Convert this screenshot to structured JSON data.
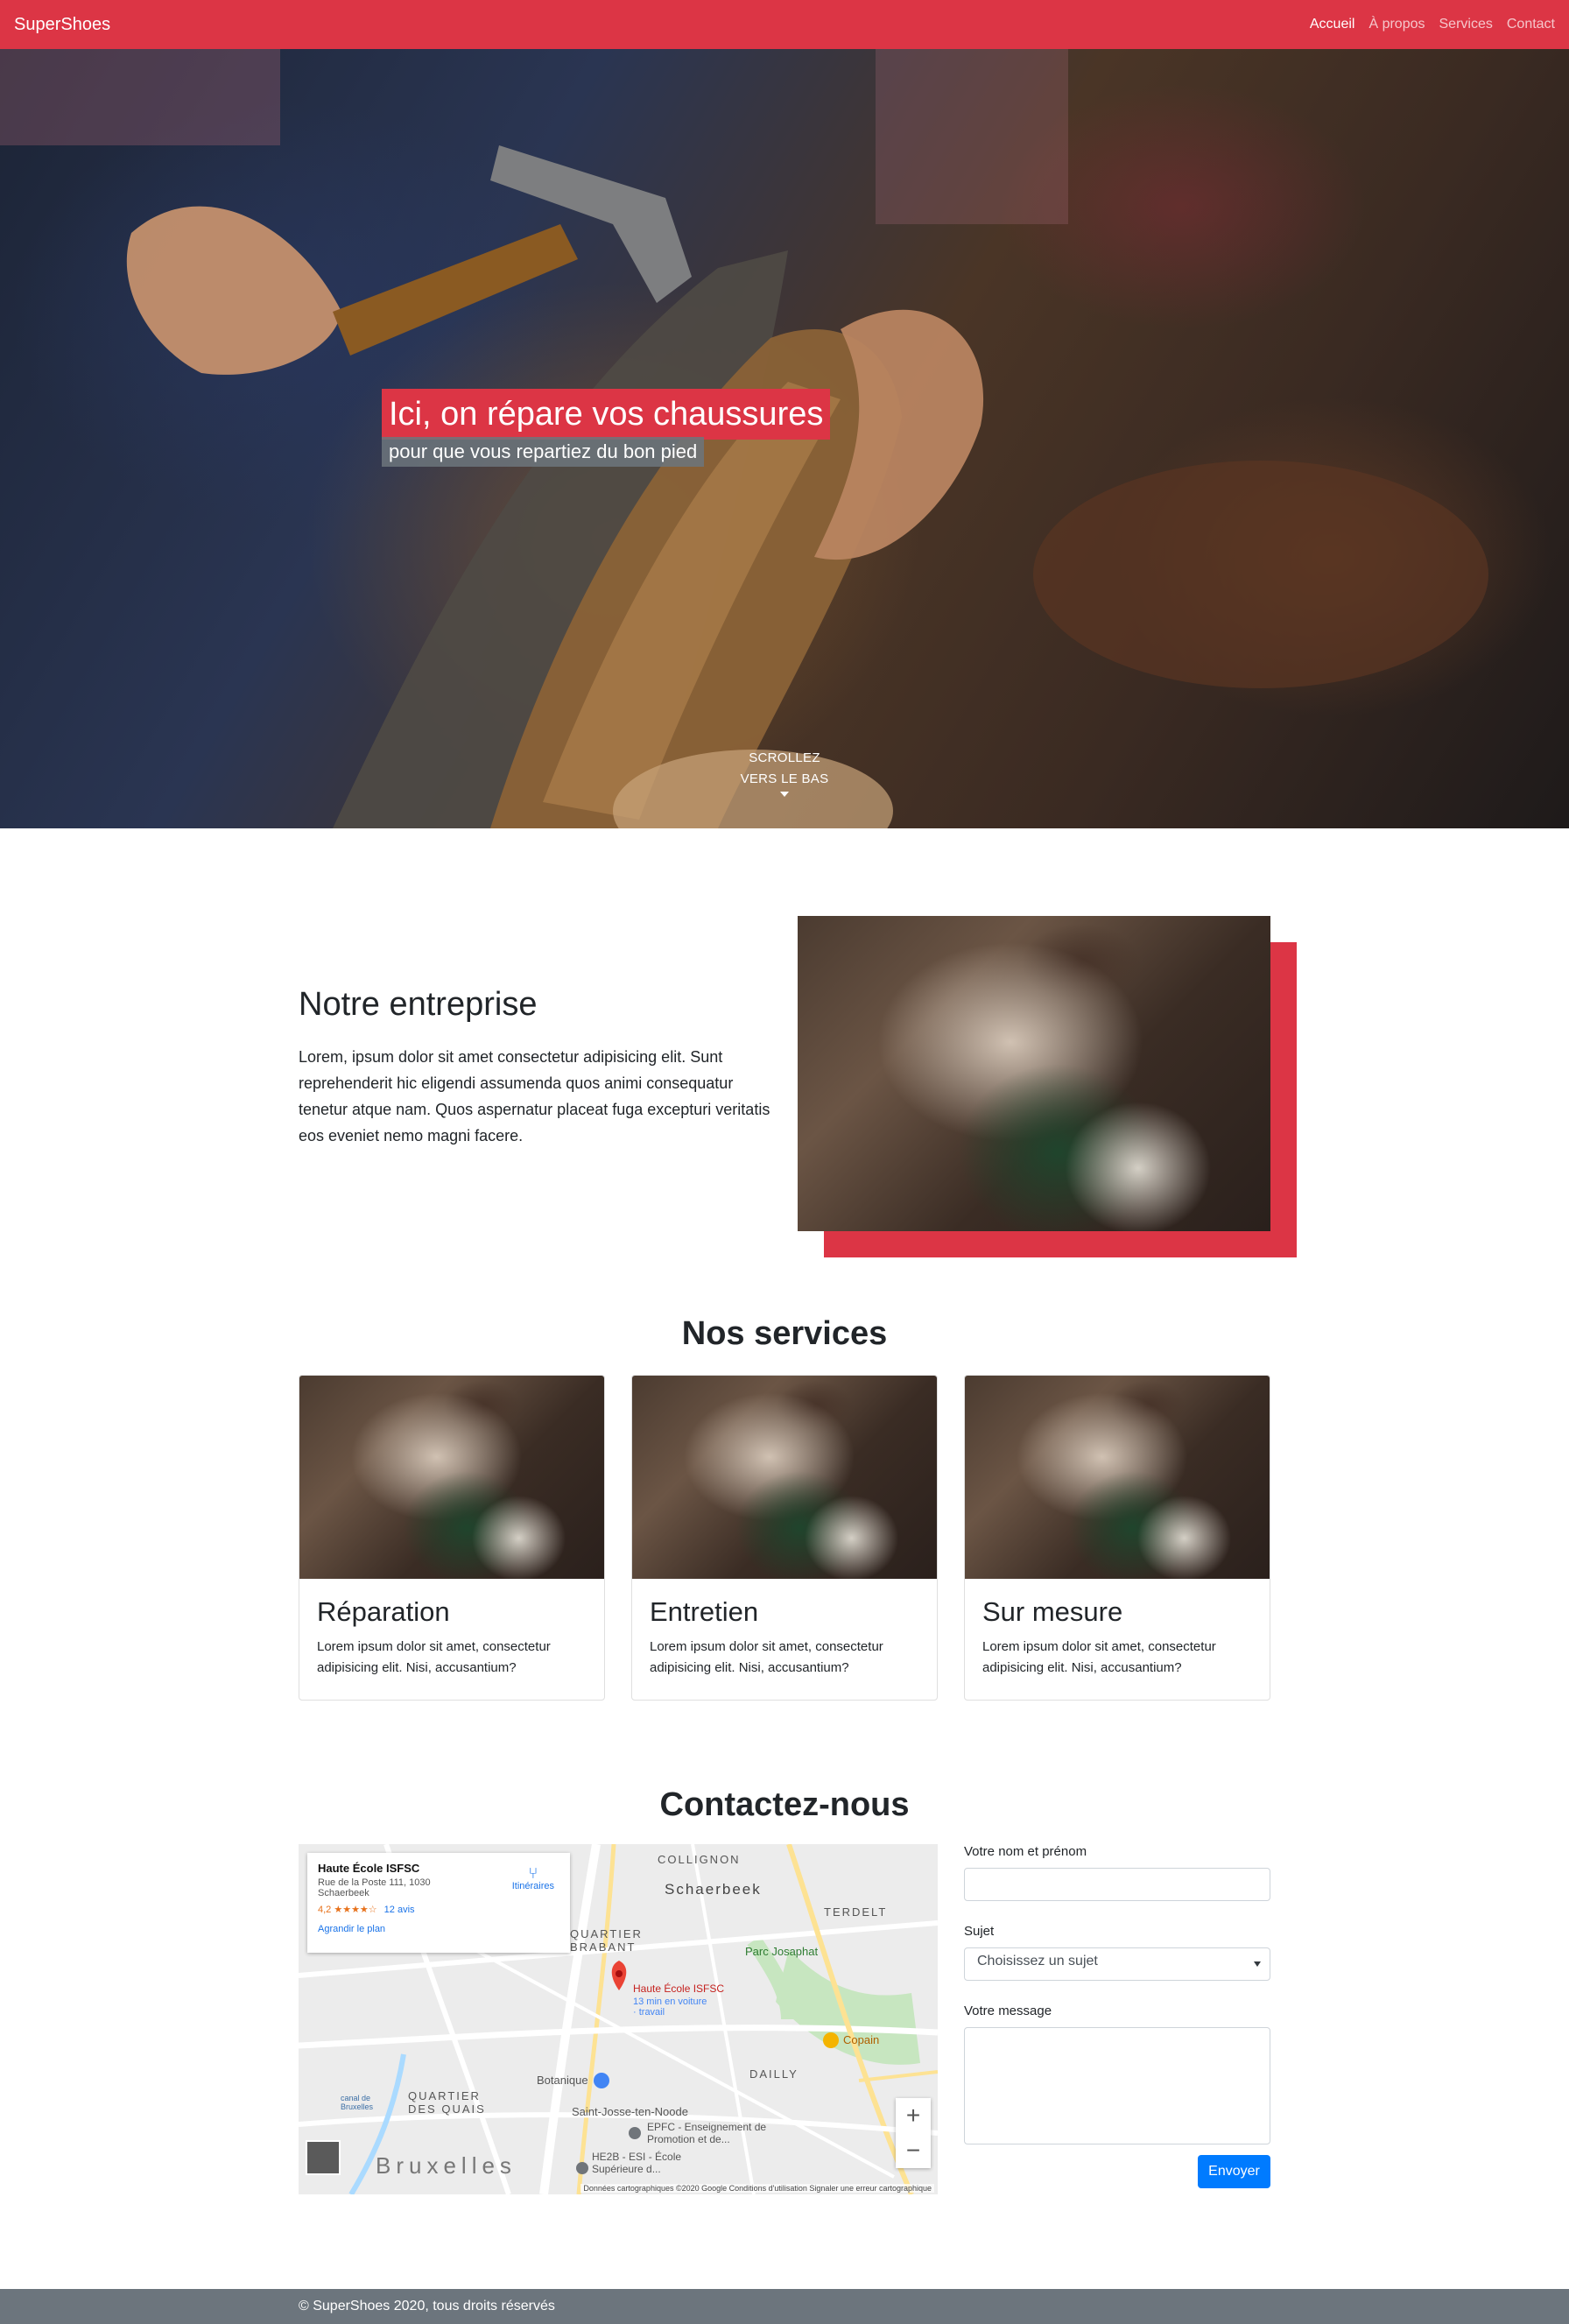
{
  "navbar": {
    "brand": "SuperShoes",
    "links": [
      "Accueil",
      "À propos",
      "Services",
      "Contact"
    ],
    "active_index": 0
  },
  "hero": {
    "title": "Ici, on répare vos chaussures",
    "subtitle": "pour que vous repartiez du bon pied",
    "scroll_line1": "SCROLLEZ",
    "scroll_line2": "VERS LE BAS"
  },
  "about": {
    "title": "Notre entreprise",
    "text": "Lorem, ipsum dolor sit amet consectetur adipisicing elit. Sunt reprehenderit hic eligendi assumenda quos animi consequatur tenetur atque nam. Quos aspernatur placeat fuga excepturi veritatis eos eveniet nemo magni facere."
  },
  "services": {
    "title": "Nos services",
    "cards": [
      {
        "title": "Réparation",
        "text": "Lorem ipsum dolor sit amet, consectetur adipisicing elit. Nisi, accusantium?"
      },
      {
        "title": "Entretien",
        "text": "Lorem ipsum dolor sit amet, consectetur adipisicing elit. Nisi, accusantium?"
      },
      {
        "title": "Sur mesure",
        "text": "Lorem ipsum dolor sit amet, consectetur adipisicing elit. Nisi, accusantium?"
      }
    ]
  },
  "contact": {
    "title": "Contactez-nous",
    "map": {
      "place_name": "Haute École ISFSC",
      "address_line1": "Rue de la Poste 111, 1030",
      "address_line2": "Schaerbeek",
      "rating": "4,2 ★★★★☆",
      "reviews": "12 avis",
      "enlarge": "Agrandir le plan",
      "directions": "Itinéraires",
      "pin_label": "Haute École ISFSC",
      "pin_sub": "13 min en voiture · travail",
      "labels": {
        "collignon": "COLLIGNON",
        "schaerbeek": "Schaerbeek",
        "terdelt": "TERDELT",
        "quartier_brabant": "QUARTIER BRABANT",
        "parc_josaphat": "Parc Josaphat",
        "copain": "Copain",
        "dailly": "DAILLY",
        "botanique": "Botanique",
        "quartier_quais": "QUARTIER DES QUAIS",
        "saint_josse": "Saint-Josse-ten-Noode",
        "epfc": "EPFC - Enseignement de Promotion et de...",
        "he2b": "HE2B - ESI - École Supérieure d...",
        "bruxelles": "Bruxelles",
        "canal": "canal de Bruxelles"
      },
      "footer": "Données cartographiques ©2020 Google   Conditions d'utilisation   Signaler une erreur cartographique"
    },
    "form": {
      "name_label": "Votre nom et prénom",
      "subject_label": "Sujet",
      "subject_value": "Choisissez un sujet",
      "message_label": "Votre message",
      "submit": "Envoyer"
    }
  },
  "footer": {
    "text": "© SuperShoes 2020, tous droits réservés"
  },
  "colors": {
    "primary_red": "#dc3545",
    "button_blue": "#007bff",
    "footer_gray": "#6c757d"
  }
}
